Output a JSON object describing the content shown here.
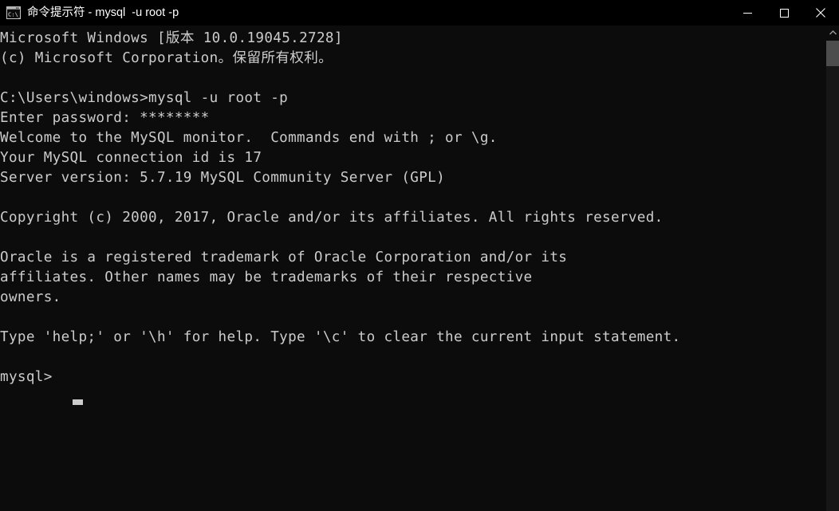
{
  "window": {
    "title": "命令提示符 - mysql  -u root -p",
    "icon": "cmd-console-icon",
    "background_color": "#0c0c0c",
    "titlebar_color": "#000000",
    "text_color": "#cccccc"
  },
  "window_controls": {
    "minimize_label": "最小化",
    "maximize_label": "最大化",
    "close_label": "关闭",
    "minimize_icon": "minimize-icon",
    "maximize_icon": "maximize-icon",
    "close_icon": "close-icon"
  },
  "scrollbar": {
    "up_arrow_icon": "scroll-up-arrow-icon",
    "thumb_color": "#4d4d4d",
    "track_color": "#171717"
  },
  "console": {
    "lines": [
      "Microsoft Windows [版本 10.0.19045.2728]",
      "(c) Microsoft Corporation。保留所有权利。",
      "",
      "C:\\Users\\windows>mysql -u root -p",
      "Enter password: ********",
      "Welcome to the MySQL monitor.  Commands end with ; or \\g.",
      "Your MySQL connection id is 17",
      "Server version: 5.7.19 MySQL Community Server (GPL)",
      "",
      "Copyright (c) 2000, 2017, Oracle and/or its affiliates. All rights reserved.",
      "",
      "Oracle is a registered trademark of Oracle Corporation and/or its",
      "affiliates. Other names may be trademarks of their respective",
      "owners.",
      "",
      "Type 'help;' or '\\h' for help. Type '\\c' to clear the current input statement.",
      "",
      "mysql> "
    ],
    "os_banner": "Microsoft Windows [版本 10.0.19045.2728]",
    "os_copyright": "(c) Microsoft Corporation。保留所有权利。",
    "command_prompt_path": "C:\\Users\\windows>",
    "command": "mysql -u root -p",
    "password_prompt": "Enter password: ",
    "password_mask": "********",
    "mysql_welcome": "Welcome to the MySQL monitor.  Commands end with ; or \\g.",
    "connection_id_line": "Your MySQL connection id is 17",
    "connection_id": "17",
    "server_version_line": "Server version: 5.7.19 MySQL Community Server (GPL)",
    "server_version": "5.7.19",
    "oracle_copyright": "Copyright (c) 2000, 2017, Oracle and/or its affiliates. All rights reserved.",
    "trademark_line_1": "Oracle is a registered trademark of Oracle Corporation and/or its",
    "trademark_line_2": "affiliates. Other names may be trademarks of their respective",
    "trademark_line_3": "owners.",
    "help_line": "Type 'help;' or '\\h' for help. Type '\\c' to clear the current input statement.",
    "prompt": "mysql> ",
    "cursor": "block-cursor"
  }
}
